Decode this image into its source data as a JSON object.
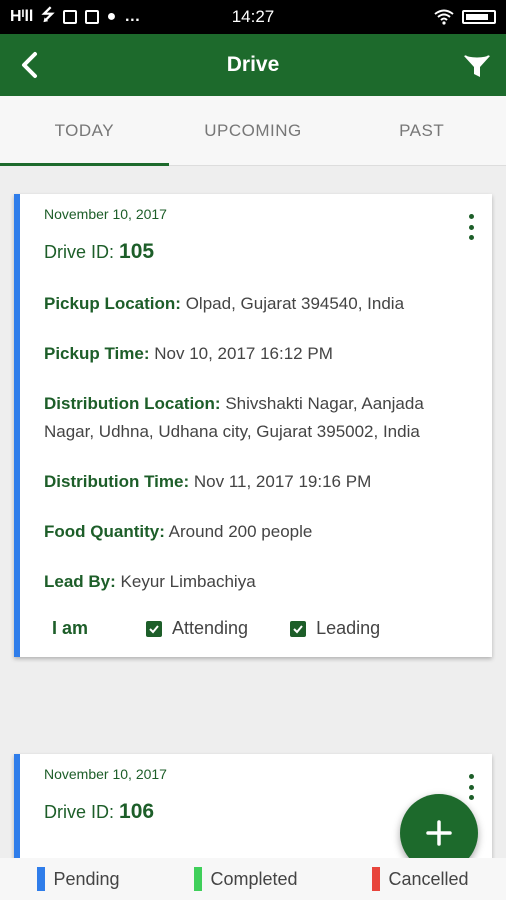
{
  "status_bar": {
    "time": "14:27",
    "carrier_text": "Hᴵll"
  },
  "app_bar": {
    "title": "Drive",
    "back_icon": "back-arrow-icon",
    "filter_icon": "filter-icon"
  },
  "tabs": [
    {
      "label": "TODAY",
      "active": true
    },
    {
      "label": "UPCOMING",
      "active": false
    },
    {
      "label": "PAST",
      "active": false
    }
  ],
  "cards": [
    {
      "date": "November 10, 2017",
      "drive_id_label": "Drive ID:",
      "drive_id": "105",
      "pickup_location_label": "Pickup Location:",
      "pickup_location": "Olpad, Gujarat 394540, India",
      "pickup_time_label": "Pickup Time:",
      "pickup_time": "Nov 10, 2017 16:12 PM",
      "distribution_location_label": "Distribution Location:",
      "distribution_location": "Shivshakti Nagar, Aanjada Nagar, Udhna, Udhana city, Gujarat 395002, India",
      "distribution_time_label": "Distribution Time:",
      "distribution_time": "Nov 11, 2017 19:16 PM",
      "food_quantity_label": "Food Quantity:",
      "food_quantity": "Around 200 people",
      "lead_by_label": "Lead By:",
      "lead_by": "Keyur Limbachiya",
      "i_am_label": "I am",
      "attending_label": "Attending",
      "leading_label": "Leading",
      "attending_checked": true,
      "leading_checked": true,
      "status_color": "#2f7dea"
    },
    {
      "date": "November 10, 2017",
      "drive_id_label": "Drive ID:",
      "drive_id": "106",
      "status_color": "#2f7dea"
    }
  ],
  "fab": {
    "icon": "plus-icon"
  },
  "legend": [
    {
      "label": "Pending",
      "color": "#2f7dea"
    },
    {
      "label": "Completed",
      "color": "#3fcf5a"
    },
    {
      "label": "Cancelled",
      "color": "#e8453c"
    }
  ],
  "colors": {
    "primary": "#1d6a2c",
    "text_green": "#1d5e29"
  }
}
